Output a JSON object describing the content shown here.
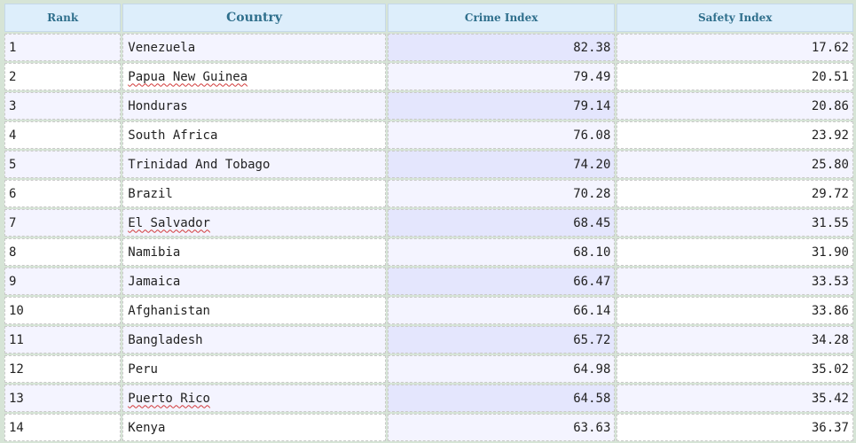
{
  "table": {
    "headers": {
      "rank": "Rank",
      "country": "Country",
      "crime": "Crime Index",
      "safety": "Safety Index"
    },
    "rows": [
      {
        "rank": "1",
        "country": "Venezuela",
        "crime": "82.38",
        "safety": "17.62",
        "spell_flag": false
      },
      {
        "rank": "2",
        "country": "Papua New Guinea",
        "crime": "79.49",
        "safety": "20.51",
        "spell_flag": true
      },
      {
        "rank": "3",
        "country": "Honduras",
        "crime": "79.14",
        "safety": "20.86",
        "spell_flag": false
      },
      {
        "rank": "4",
        "country": "South Africa",
        "crime": "76.08",
        "safety": "23.92",
        "spell_flag": false
      },
      {
        "rank": "5",
        "country": "Trinidad And Tobago",
        "crime": "74.20",
        "safety": "25.80",
        "spell_flag": false
      },
      {
        "rank": "6",
        "country": "Brazil",
        "crime": "70.28",
        "safety": "29.72",
        "spell_flag": false
      },
      {
        "rank": "7",
        "country": "El Salvador",
        "crime": "68.45",
        "safety": "31.55",
        "spell_flag": true
      },
      {
        "rank": "8",
        "country": "Namibia",
        "crime": "68.10",
        "safety": "31.90",
        "spell_flag": false
      },
      {
        "rank": "9",
        "country": "Jamaica",
        "crime": "66.47",
        "safety": "33.53",
        "spell_flag": false
      },
      {
        "rank": "10",
        "country": "Afghanistan",
        "crime": "66.14",
        "safety": "33.86",
        "spell_flag": false
      },
      {
        "rank": "11",
        "country": "Bangladesh",
        "crime": "65.72",
        "safety": "34.28",
        "spell_flag": false
      },
      {
        "rank": "12",
        "country": "Peru",
        "crime": "64.98",
        "safety": "35.02",
        "spell_flag": false
      },
      {
        "rank": "13",
        "country": "Puerto Rico",
        "crime": "64.58",
        "safety": "35.42",
        "spell_flag": true
      },
      {
        "rank": "14",
        "country": "Kenya",
        "crime": "63.63",
        "safety": "36.37",
        "spell_flag": false
      }
    ]
  },
  "colors": {
    "header_bg": "#ddeefb",
    "header_text": "#2f6f8c",
    "row_alt_bg": "#f4f4ff",
    "crime_col_alt_bg": "#e4e6fd",
    "spellcheck_underline": "#d23a3a"
  }
}
